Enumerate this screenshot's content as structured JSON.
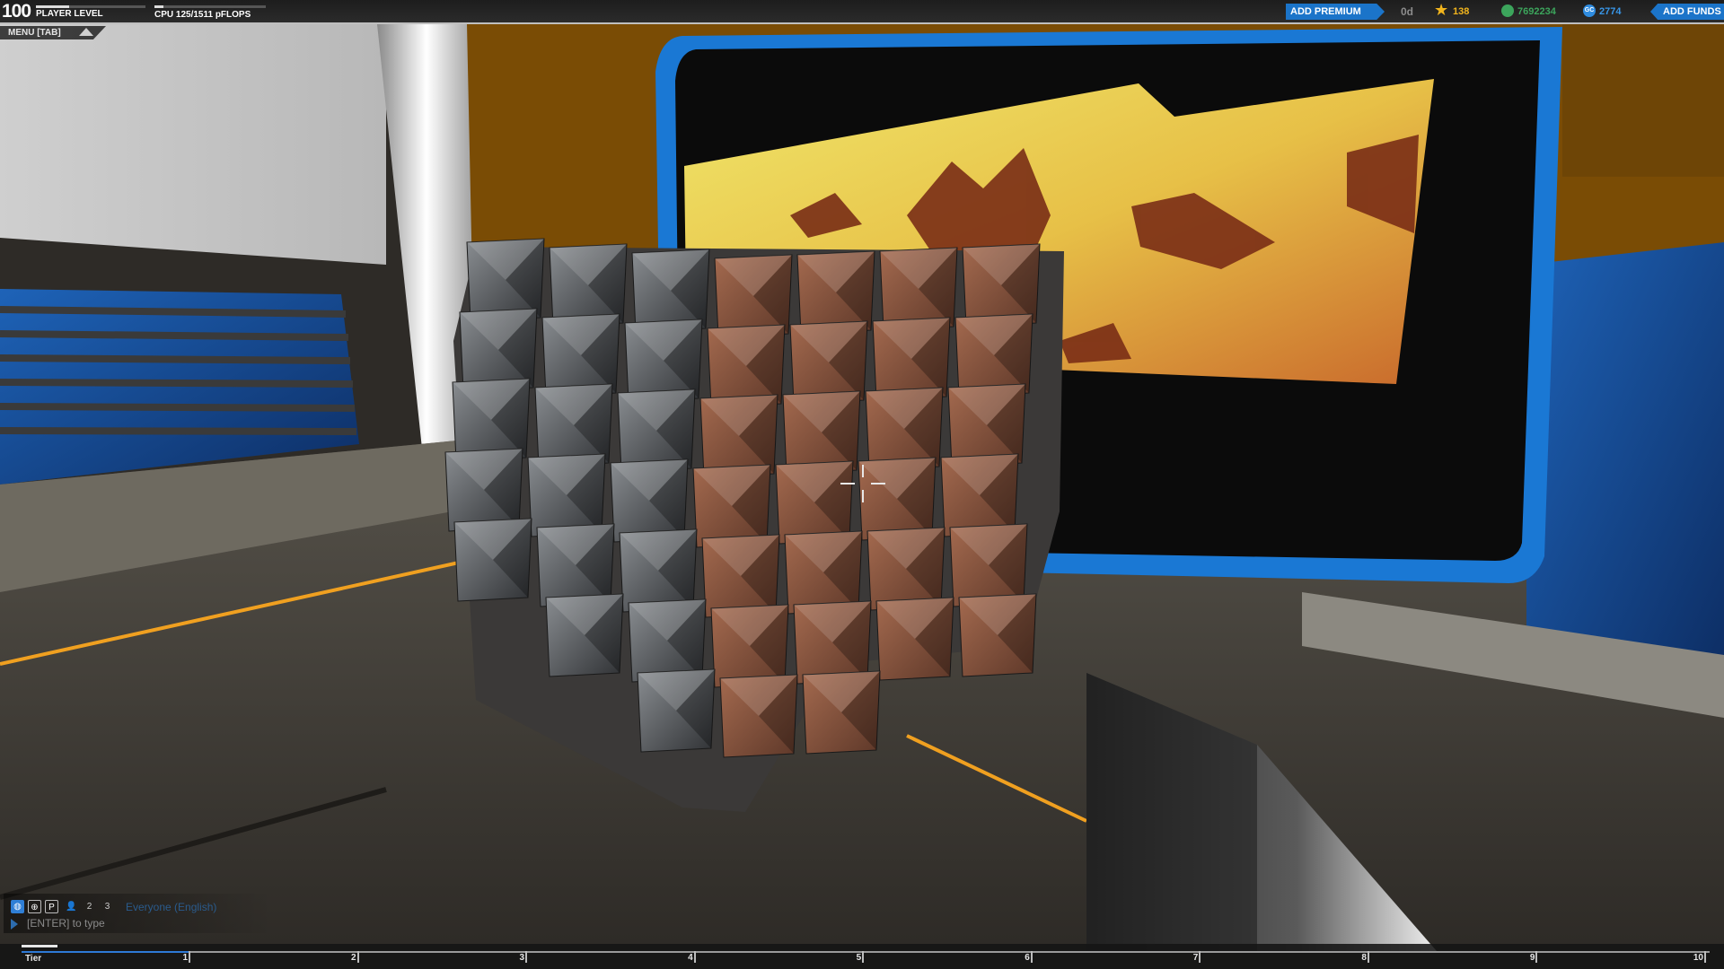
{
  "hud": {
    "player_level": "100",
    "player_level_label": "PLAYER LEVEL",
    "level_progress": 0.3,
    "cpu_label": "CPU 125/1511 pFLOPS",
    "cpu_progress": 0.08,
    "add_premium_label": "ADD PREMIUM",
    "premium_days": "0d",
    "stars": "138",
    "robits": "7692234",
    "galaxy_coins": "2774",
    "add_funds_label": "ADD FUNDS",
    "icons": {
      "stars": "star-icon",
      "robits": "robits-icon",
      "galaxy_coins": "gc-icon"
    },
    "colors": {
      "accent_blue": "#1b74c9",
      "stars": "#f2b51d",
      "robits": "#3ca55c",
      "galaxy_coins": "#3896e8"
    }
  },
  "menu": {
    "label": "MENU [TAB]",
    "icon": "chevron-up-icon"
  },
  "chat": {
    "channel": "Everyone (English)",
    "input_placeholder": "[ENTER] to type",
    "filter_icons": [
      "globe-icon",
      "target-icon",
      "flag-icon",
      "user-icon",
      "user-2-icon",
      "user-3-icon"
    ],
    "filter_glyphs": [
      "◍",
      "⊕",
      "P",
      "👤",
      "2",
      "3"
    ]
  },
  "tier_bar": {
    "label": "Tier",
    "current_tier_progress": 0.1,
    "ticks": [
      "1",
      "2",
      "3",
      "4",
      "5",
      "6",
      "7",
      "8",
      "9",
      "10"
    ]
  },
  "scene": {
    "description_colors": {
      "floor": "#3d3a34",
      "wall": "#d9d9d9",
      "screen_frame": "#1a78d4",
      "accent_orange": "#f0a020",
      "armor_copper": "#7a4e3a",
      "armor_steel": "#4e5154"
    }
  }
}
